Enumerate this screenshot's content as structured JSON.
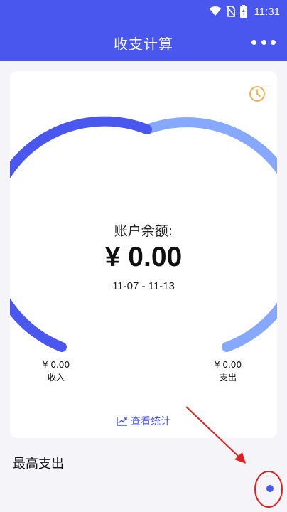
{
  "status_bar": {
    "time": "11:31"
  },
  "app_bar": {
    "title": "收支计算",
    "more_icon": "more-horizontal-icon"
  },
  "card": {
    "history_icon": "clock-icon",
    "balance_label": "账户余额:",
    "balance_value": "¥ 0.00",
    "date_range": "11-07 - 11-13",
    "income": {
      "amount": "¥ 0.00",
      "label": "收入"
    },
    "expense": {
      "amount": "¥ 0.00",
      "label": "支出"
    },
    "stats_link": "查看统计",
    "stats_icon": "chart-trend-icon",
    "gauge_colors": {
      "income": "#4a57ee",
      "expense": "#86a9ff"
    }
  },
  "section": {
    "title": "最高支出"
  },
  "annotation": {
    "color": "#e02020"
  }
}
